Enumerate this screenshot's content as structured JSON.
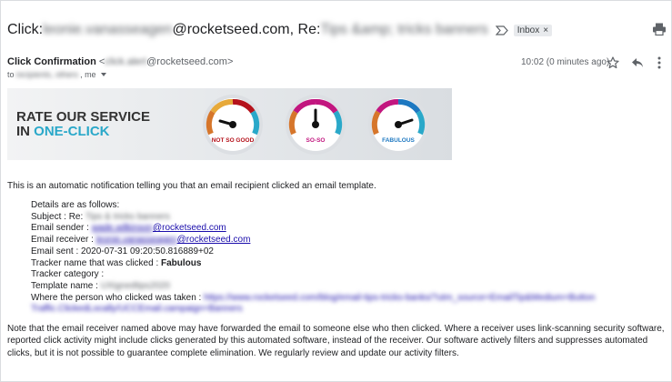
{
  "subject": {
    "prefix": "Click: ",
    "recipient_hidden": "leonie.vanasseagen",
    "domain": "@rocketseed.com, Re: ",
    "title_hidden": "Tips &amp; tricks banners",
    "label": "Inbox",
    "label_close": "×"
  },
  "sender": {
    "name": "Click Confirmation",
    "email_hidden": "click.alert",
    "email_domain": "@rocketseed.com>",
    "email_open": "<",
    "to_prefix": "to ",
    "to_hidden": "recipients, others",
    "to_suffix": ", me",
    "time": "10:02 (0 minutes ago)"
  },
  "banner": {
    "line1": "RATE OUR SERVICE",
    "line2_plain": "IN ",
    "line2_accent": "ONE-CLICK",
    "gauges": [
      {
        "label": "NOT SO GOOD",
        "label_color": "#b5121b"
      },
      {
        "label": "SO-SO",
        "label_color": "#c2167f"
      },
      {
        "label": "FABULOUS",
        "label_color": "#1d78c1"
      }
    ]
  },
  "intro": "This is an automatic notification telling you that an email recipient clicked an email template.",
  "details": {
    "heading": "Details are as follows:",
    "subject_label": "Subject : Re: ",
    "subject_value_hidden": "Tips & tricks banners",
    "sender_label": "Email sender : ",
    "sender_value_hidden": "wade.wilkinson",
    "sender_domain": "@rocketseed.com",
    "receiver_label": "Email receiver : ",
    "receiver_value_hidden": "leonie.vanasseagen",
    "receiver_domain": "@rocketseed.com",
    "sent_label": "Email sent : 2020-07-31 09:20:50.816889+02",
    "tracker_name_label": "Tracker name that was clicked : ",
    "tracker_name_value": "Fabulous",
    "tracker_category_label": "Tracker category :",
    "template_label": "Template name : ",
    "template_value_hidden": "UXignedtips2020",
    "where_label": "Where the person who clicked was taken : ",
    "where_value_hidden": "https://www.rocketseed.com/blog/email-tips-tricks-banks/?utm_source=EmailTip&Medium=Button",
    "where_value_hidden_2": "Traffic.ClickedLocally/UCCEmail.campaign=Banners"
  },
  "note": "Note that the email receiver named above may have forwarded the email to someone else who then clicked. Where a receiver uses link-scanning security software, reported click activity might include clicks generated by this automated software, instead of the receiver. Our software actively filters and suppresses automated clicks, but it is not possible to guarantee complete elimination. We regularly review and update our activity filters.",
  "icons": {
    "important": "important-marker-icon",
    "print": "print-icon",
    "star": "star-icon",
    "reply": "reply-icon",
    "more": "more-vert-icon"
  },
  "colors": {
    "link": "#1a0dab",
    "accent": "#2aa8c9",
    "gauge_red": "#b5121b",
    "gauge_magenta": "#c2167f",
    "gauge_blue": "#1d78c1"
  }
}
